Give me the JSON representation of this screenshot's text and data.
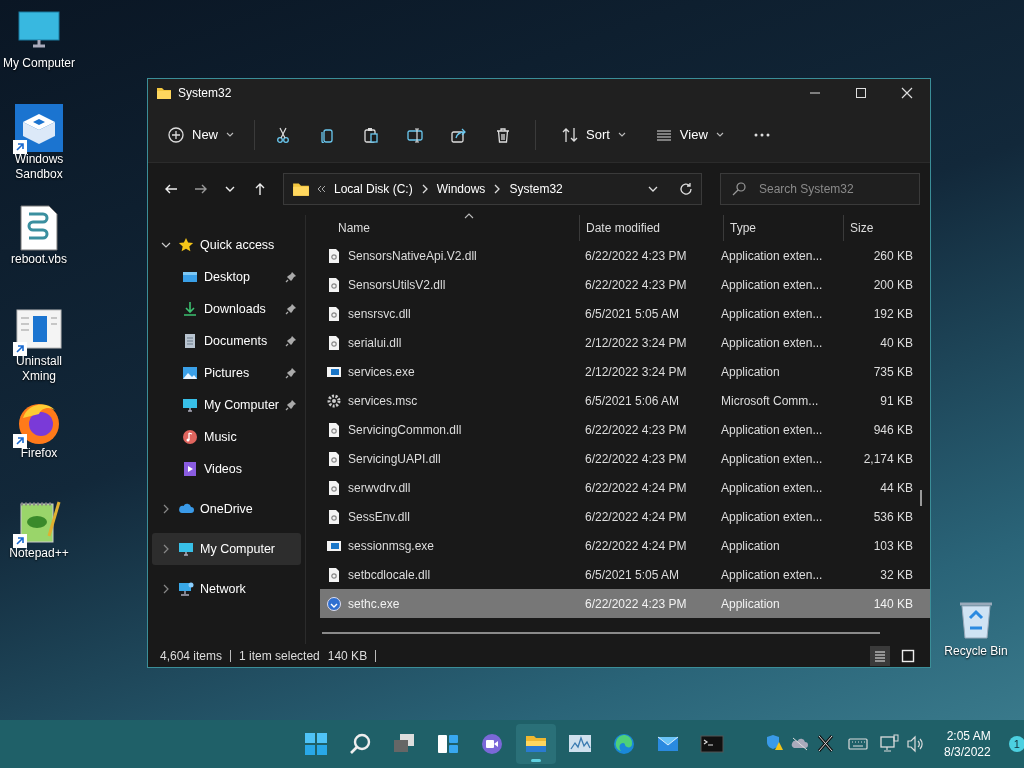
{
  "desktop_icons": [
    {
      "label": "My Computer",
      "kind": "computer",
      "shortcut": false
    },
    {
      "label": "Windows Sandbox",
      "kind": "sandbox",
      "shortcut": true
    },
    {
      "label": "reboot.vbs",
      "kind": "script",
      "shortcut": false
    },
    {
      "label": "Uninstall Xming",
      "kind": "uninstaller",
      "shortcut": true
    },
    {
      "label": "Firefox",
      "kind": "browser",
      "shortcut": true
    },
    {
      "label": "Notepad++",
      "kind": "notepad",
      "shortcut": true
    }
  ],
  "recycle_bin": {
    "label": "Recycle Bin"
  },
  "window": {
    "title": "System32"
  },
  "toolbar": [
    {
      "kind": "new",
      "label": "New"
    },
    {
      "kind": "cut"
    },
    {
      "kind": "copy"
    },
    {
      "kind": "paste"
    },
    {
      "kind": "rename"
    },
    {
      "kind": "share"
    },
    {
      "kind": "delete"
    },
    {
      "kind": "sort",
      "label": "Sort"
    },
    {
      "kind": "view",
      "label": "View"
    },
    {
      "kind": "more"
    }
  ],
  "address": {
    "breadcrumbs": [
      "Local Disk (C:)",
      "Windows",
      "System32"
    ]
  },
  "search": {
    "placeholder": "Search System32"
  },
  "sidebar": [
    {
      "label": "Quick access",
      "kind": "star",
      "expanded": true,
      "selected": false,
      "children": [
        {
          "label": "Desktop",
          "kind": "desktop",
          "pinned": true,
          "selected": false
        },
        {
          "label": "Downloads",
          "kind": "downloads",
          "pinned": true,
          "selected": false
        },
        {
          "label": "Documents",
          "kind": "documents",
          "pinned": true,
          "selected": false
        },
        {
          "label": "Pictures",
          "kind": "pictures",
          "pinned": true,
          "selected": false
        },
        {
          "label": "My Computer",
          "kind": "computer",
          "pinned": true,
          "selected": false
        },
        {
          "label": "Music",
          "kind": "music",
          "pinned": false,
          "selected": false
        },
        {
          "label": "Videos",
          "kind": "videos",
          "pinned": false,
          "selected": false
        }
      ]
    },
    {
      "label": "OneDrive",
      "kind": "cloud",
      "expanded": false,
      "selected": false
    },
    {
      "label": "My Computer",
      "kind": "computer",
      "expanded": false,
      "selected": true
    },
    {
      "label": "Network",
      "kind": "network",
      "expanded": false,
      "selected": false
    }
  ],
  "columns": [
    {
      "label": "Name",
      "sorted": true
    },
    {
      "label": "Date modified",
      "sorted": false
    },
    {
      "label": "Type",
      "sorted": false
    },
    {
      "label": "Size",
      "sorted": false
    }
  ],
  "files": [
    {
      "name": "SensorsNativeApi.V2.dll",
      "date": "6/22/2022 4:23 PM",
      "type": "Application exten...",
      "size": "260 KB",
      "kind": "dll",
      "selected": false
    },
    {
      "name": "SensorsUtilsV2.dll",
      "date": "6/22/2022 4:23 PM",
      "type": "Application exten...",
      "size": "200 KB",
      "kind": "dll",
      "selected": false
    },
    {
      "name": "sensrsvc.dll",
      "date": "6/5/2021 5:05 AM",
      "type": "Application exten...",
      "size": "192 KB",
      "kind": "dll",
      "selected": false
    },
    {
      "name": "serialui.dll",
      "date": "2/12/2022 3:24 PM",
      "type": "Application exten...",
      "size": "40 KB",
      "kind": "dll",
      "selected": false
    },
    {
      "name": "services.exe",
      "date": "2/12/2022 3:24 PM",
      "type": "Application",
      "size": "735 KB",
      "kind": "exe",
      "selected": false
    },
    {
      "name": "services.msc",
      "date": "6/5/2021 5:06 AM",
      "type": "Microsoft Comm...",
      "size": "91 KB",
      "kind": "msc",
      "selected": false
    },
    {
      "name": "ServicingCommon.dll",
      "date": "6/22/2022 4:23 PM",
      "type": "Application exten...",
      "size": "946 KB",
      "kind": "dll",
      "selected": false
    },
    {
      "name": "ServicingUAPI.dll",
      "date": "6/22/2022 4:23 PM",
      "type": "Application exten...",
      "size": "2,174 KB",
      "kind": "dll",
      "selected": false
    },
    {
      "name": "serwvdrv.dll",
      "date": "6/22/2022 4:24 PM",
      "type": "Application exten...",
      "size": "44 KB",
      "kind": "dll",
      "selected": false
    },
    {
      "name": "SessEnv.dll",
      "date": "6/22/2022 4:24 PM",
      "type": "Application exten...",
      "size": "536 KB",
      "kind": "dll",
      "selected": false
    },
    {
      "name": "sessionmsg.exe",
      "date": "6/22/2022 4:24 PM",
      "type": "Application",
      "size": "103 KB",
      "kind": "exe",
      "selected": false
    },
    {
      "name": "setbcdlocale.dll",
      "date": "6/5/2021 5:05 AM",
      "type": "Application exten...",
      "size": "32 KB",
      "kind": "dll",
      "selected": false
    },
    {
      "name": "sethc.exe",
      "date": "6/22/2022 4:23 PM",
      "type": "Application",
      "size": "140 KB",
      "kind": "access",
      "selected": true
    }
  ],
  "status_bar": {
    "item_count": "4,604 items",
    "selection": "1 item selected",
    "selection_size": "140 KB"
  },
  "view_buttons": [
    {
      "kind": "details",
      "selected": true
    },
    {
      "kind": "tiles",
      "selected": false
    }
  ],
  "taskbar": {
    "apps": [
      {
        "kind": "start",
        "active": false
      },
      {
        "kind": "search",
        "active": false
      },
      {
        "kind": "taskview",
        "active": false
      },
      {
        "kind": "widgets",
        "active": false
      },
      {
        "kind": "chat",
        "active": false
      },
      {
        "kind": "explorer",
        "active": true
      },
      {
        "kind": "monitor",
        "active": false
      },
      {
        "kind": "edge",
        "active": false
      },
      {
        "kind": "mail",
        "active": false
      },
      {
        "kind": "terminal",
        "active": false
      }
    ],
    "tray": [
      {
        "kind": "security"
      },
      {
        "kind": "cloud"
      },
      {
        "kind": "xapp"
      },
      {
        "kind": "keyboard"
      },
      {
        "kind": "network"
      },
      {
        "kind": "volume"
      }
    ],
    "time": "2:05 AM",
    "date": "8/3/2022",
    "notifications": "1"
  }
}
